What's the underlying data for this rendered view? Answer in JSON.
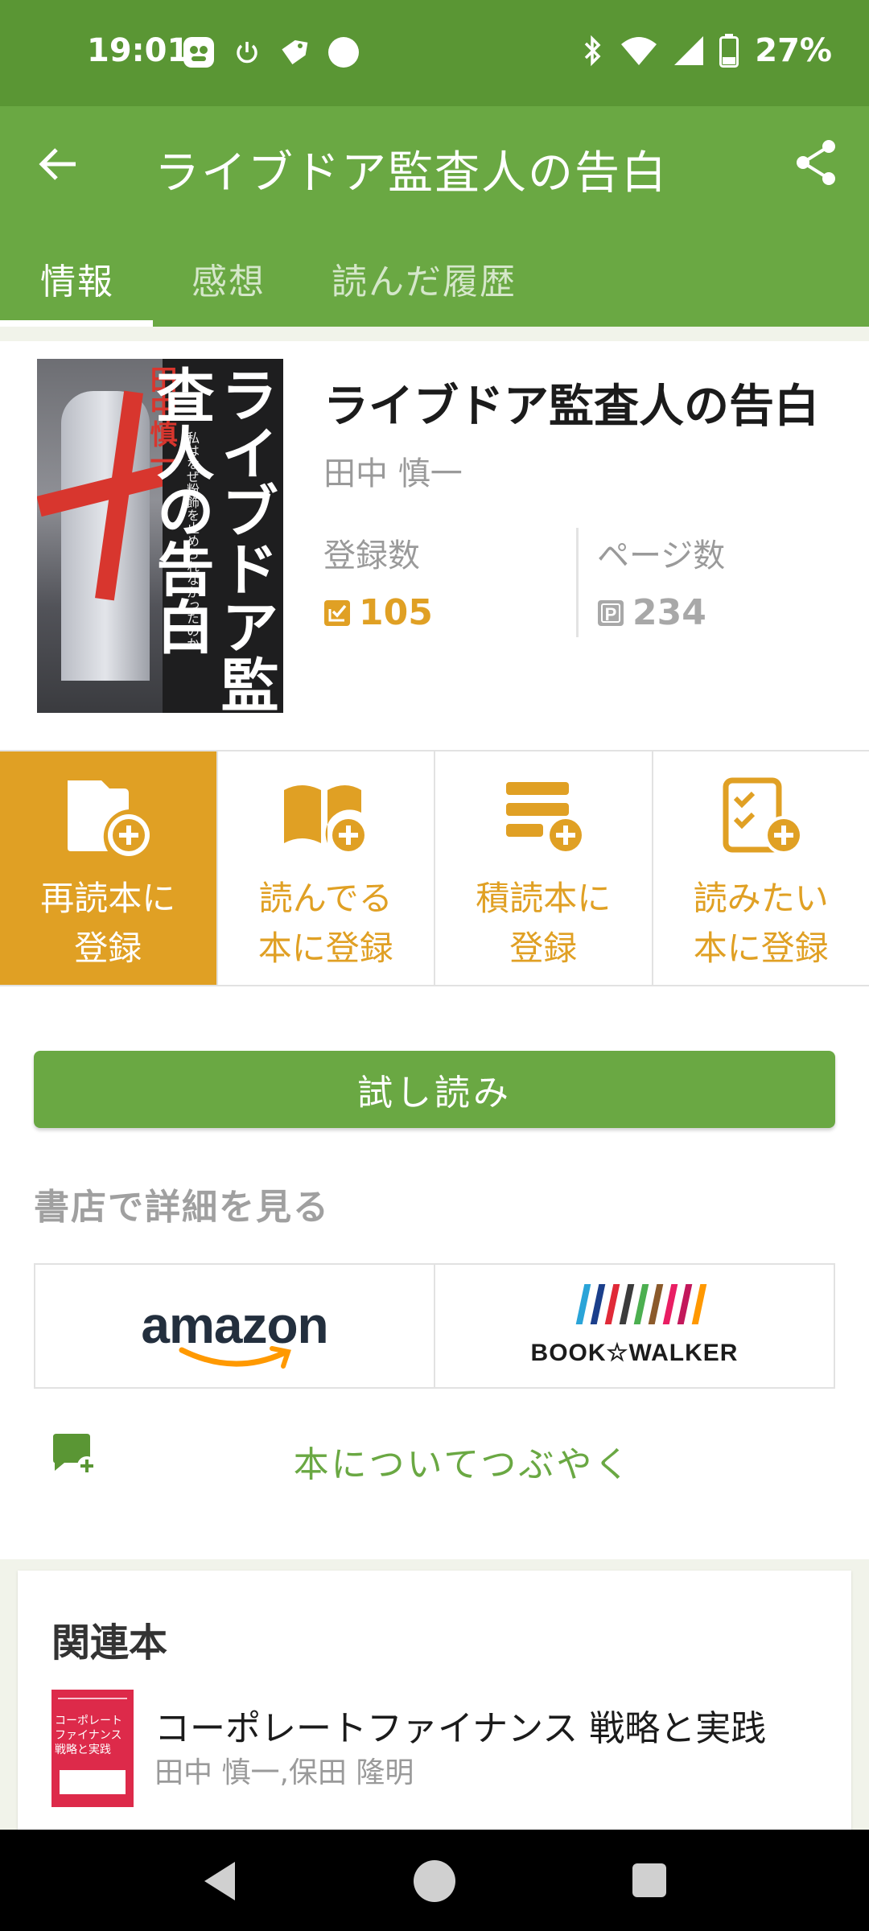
{
  "status_bar": {
    "time": "19:01",
    "battery": "27%",
    "icons_left": [
      "app-notification-icon",
      "power-icon",
      "tag-icon",
      "dot-icon"
    ],
    "icons_right": [
      "bluetooth-icon",
      "wifi-icon",
      "signal-icon",
      "battery-icon"
    ]
  },
  "app_bar": {
    "title": "ライブドア監査人の告白"
  },
  "tabs": [
    {
      "label": "情報",
      "active": true
    },
    {
      "label": "感想",
      "active": false
    },
    {
      "label": "読んだ履歴",
      "active": false
    }
  ],
  "book": {
    "title": "ライブドア監査人の告白",
    "author": "田中 慎一",
    "registrations_label": "登録数",
    "registrations": "105",
    "pages_label": "ページ数",
    "pages": "234",
    "cover_title": "ライブドア監査人の告白",
    "cover_author": "田中慎一",
    "cover_subtitle": "私はなぜ粉飾を止められなかったのか"
  },
  "actions": [
    {
      "label": "再読本に\n登録",
      "active": true,
      "icon": "reread-folder-plus-icon"
    },
    {
      "label": "読んでる\n本に登録",
      "active": false,
      "icon": "open-book-plus-icon"
    },
    {
      "label": "積読本に\n登録",
      "active": false,
      "icon": "stack-plus-icon"
    },
    {
      "label": "読みたい\n本に登録",
      "active": false,
      "icon": "checklist-plus-icon"
    }
  ],
  "trial_button": "試し読み",
  "shop_heading": "書店で詳細を見る",
  "shops": {
    "amazon": "amazon",
    "bookwalker": "BOOK☆WALKER"
  },
  "tweet": "本についてつぶやく",
  "related": {
    "heading": "関連本",
    "items": [
      {
        "title": "コーポレートファイナンス 戦略と実践",
        "author": "田中 慎一,保田 隆明",
        "cover_title": "コーポレート ファイナンス 戦略と実践"
      }
    ]
  },
  "colors": {
    "status_bar": "#5a9634",
    "primary": "#6aa843",
    "accent": "#e0a024"
  }
}
